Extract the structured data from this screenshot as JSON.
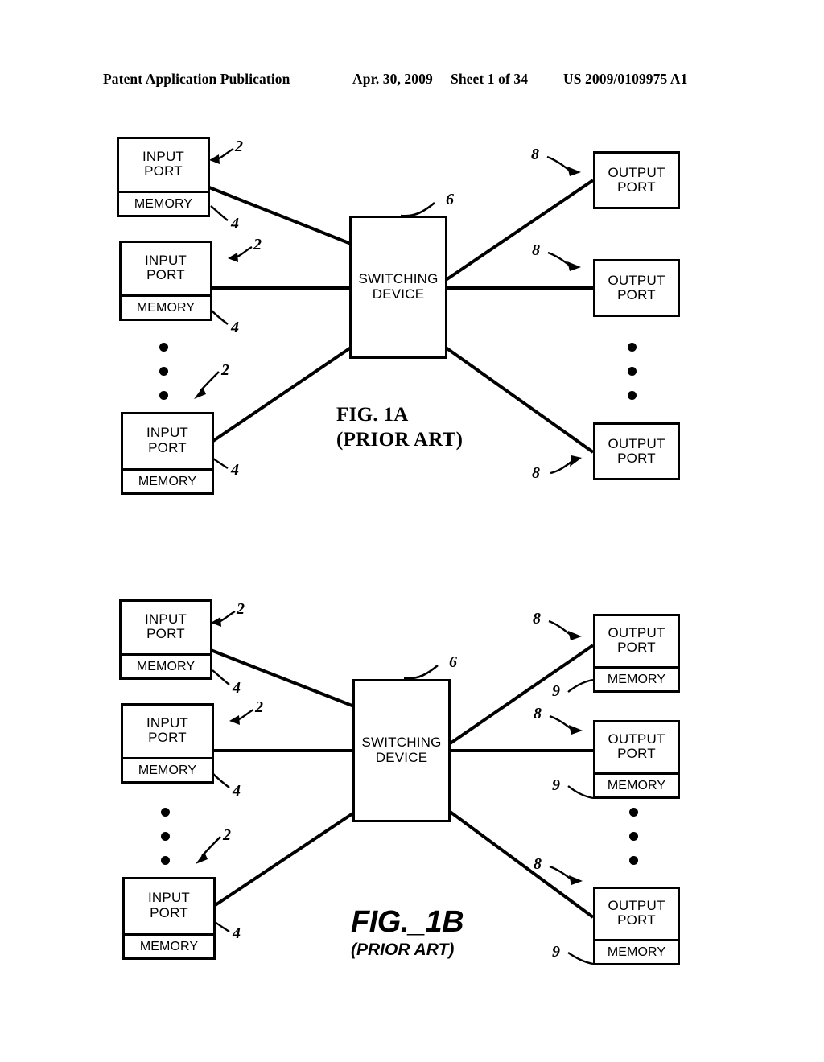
{
  "header": {
    "publication": "Patent Application Publication",
    "date": "Apr. 30, 2009",
    "sheet": "Sheet 1 of 34",
    "document_number": "US 2009/0109975 A1"
  },
  "labels": {
    "input_port": "INPUT\nPORT",
    "output_port": "OUTPUT\nPORT",
    "memory": "MEMORY",
    "switching_device": "SWITCHING\nDEVICE",
    "ref_input_port": "2",
    "ref_input_memory": "4",
    "ref_switching_device": "6",
    "ref_output_port": "8",
    "ref_output_memory": "9"
  },
  "figures": [
    {
      "id": "fig-1a",
      "caption_main": "FIG. 1A",
      "caption_sub": "(PRIOR ART)",
      "caption_style": "serif",
      "input_ports": [
        {
          "title": "INPUT\nPORT",
          "memory": "MEMORY",
          "ref_port": "2",
          "ref_memory": "4"
        },
        {
          "title": "INPUT\nPORT",
          "memory": "MEMORY",
          "ref_port": "2",
          "ref_memory": "4"
        },
        {
          "title": "INPUT\nPORT",
          "memory": "MEMORY",
          "ref_port": "2",
          "ref_memory": "4"
        }
      ],
      "switch": {
        "label": "SWITCHING\nDEVICE",
        "ref": "6"
      },
      "output_ports": [
        {
          "title": "OUTPUT\nPORT",
          "memory": null,
          "ref_port": "8",
          "ref_memory": null
        },
        {
          "title": "OUTPUT\nPORT",
          "memory": null,
          "ref_port": "8",
          "ref_memory": null
        },
        {
          "title": "OUTPUT\nPORT",
          "memory": null,
          "ref_port": "8",
          "ref_memory": null
        }
      ]
    },
    {
      "id": "fig-1b",
      "caption_main": "FIG._1B",
      "caption_sub": "(PRIOR ART)",
      "caption_style": "sans-italic",
      "input_ports": [
        {
          "title": "INPUT\nPORT",
          "memory": "MEMORY",
          "ref_port": "2",
          "ref_memory": "4"
        },
        {
          "title": "INPUT\nPORT",
          "memory": "MEMORY",
          "ref_port": "2",
          "ref_memory": "4"
        },
        {
          "title": "INPUT\nPORT",
          "memory": "MEMORY",
          "ref_port": "2",
          "ref_memory": "4"
        }
      ],
      "switch": {
        "label": "SWITCHING\nDEVICE",
        "ref": "6"
      },
      "output_ports": [
        {
          "title": "OUTPUT\nPORT",
          "memory": "MEMORY",
          "ref_port": "8",
          "ref_memory": "9"
        },
        {
          "title": "OUTPUT\nPORT",
          "memory": "MEMORY",
          "ref_port": "8",
          "ref_memory": "9"
        },
        {
          "title": "OUTPUT\nPORT",
          "memory": "MEMORY",
          "ref_port": "8",
          "ref_memory": "9"
        }
      ]
    }
  ]
}
